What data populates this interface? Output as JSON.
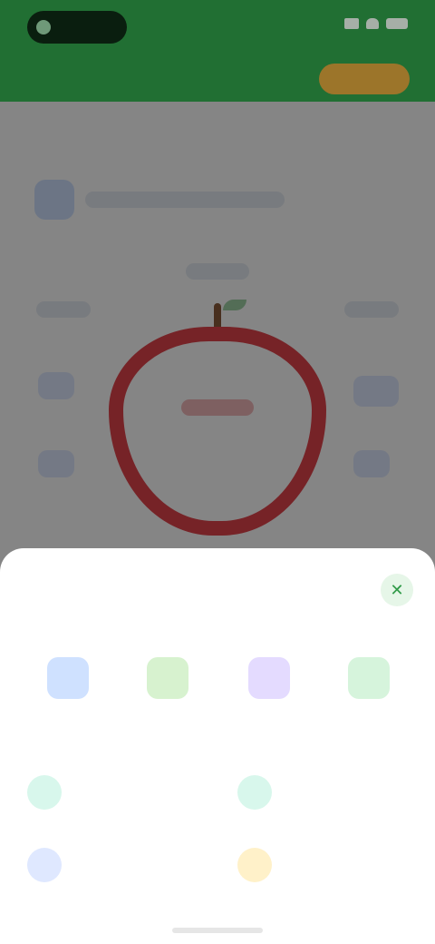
{
  "status_bar": {
    "title": "",
    "indicators": [
      "signal-icon",
      "wifi-icon",
      "battery-icon"
    ]
  },
  "header": {
    "subtitle": "",
    "upgrade_label": ""
  },
  "main": {
    "section_title": "",
    "info_text": ""
  },
  "diagram": {
    "apple_label": ""
  },
  "sheet": {
    "title": "",
    "close_icon": "close-icon",
    "share_items": [
      {
        "label": "",
        "icon": "share-icon-1",
        "color": "#cfe1ff"
      },
      {
        "label": "",
        "icon": "share-icon-2",
        "color": "#d7f2cf"
      },
      {
        "label": "",
        "icon": "share-icon-3",
        "color": "#e4dbff"
      },
      {
        "label": "",
        "icon": "share-icon-4",
        "color": "#d6f4dc"
      }
    ],
    "actions": [
      {
        "label": "",
        "icon": "action-icon-1",
        "color": "#d8f7ec"
      },
      {
        "label": "",
        "icon": "action-icon-2",
        "color": "#d8f7ec"
      },
      {
        "label": "",
        "icon": "action-icon-3",
        "color": "#dfe8ff"
      },
      {
        "label": "",
        "icon": "action-icon-4",
        "color": "#fff1c9"
      }
    ]
  },
  "colors": {
    "primary_green": "#2f9a47",
    "accent_gold": "#d8a23b",
    "apple_red": "#e2434b"
  }
}
